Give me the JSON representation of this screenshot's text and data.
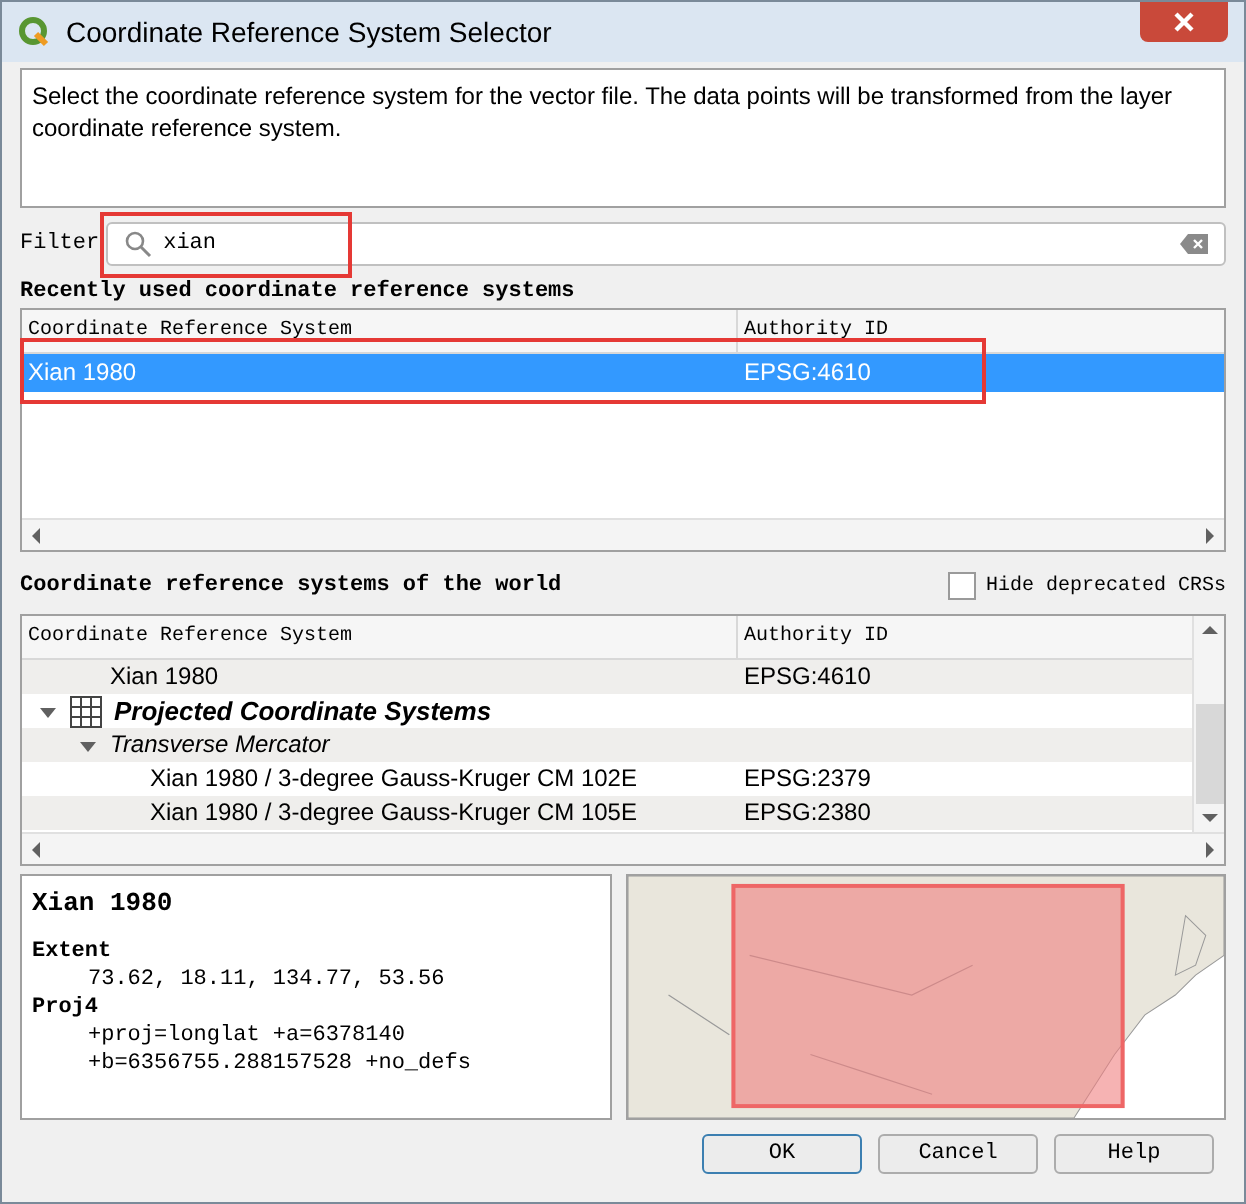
{
  "window": {
    "title": "Coordinate Reference System Selector"
  },
  "description": "Select the coordinate reference system for the vector file. The data points will be transformed from the layer coordinate reference system.",
  "filter": {
    "label": "Filter",
    "value": "xian"
  },
  "recent": {
    "heading": "Recently used coordinate reference systems",
    "columns": [
      "Coordinate Reference System",
      "Authority ID"
    ],
    "rows": [
      {
        "name": "Xian 1980",
        "authority_id": "EPSG:4610",
        "selected": true
      }
    ]
  },
  "world": {
    "heading": "Coordinate reference systems of the world",
    "hide_deprecated": {
      "label": "Hide deprecated CRSs",
      "checked": false
    },
    "columns": [
      "Coordinate Reference System",
      "Authority ID"
    ],
    "tree": [
      {
        "kind": "crs",
        "name": "Xian 1980",
        "authority_id": "EPSG:4610"
      },
      {
        "kind": "group",
        "name": "Projected Coordinate Systems",
        "expanded": true,
        "children": [
          {
            "kind": "projection",
            "name": "Transverse Mercator",
            "expanded": true,
            "children": [
              {
                "kind": "crs",
                "name": "Xian 1980 / 3-degree Gauss-Kruger CM 102E",
                "authority_id": "EPSG:2379"
              },
              {
                "kind": "crs",
                "name": "Xian 1980 / 3-degree Gauss-Kruger CM 105E",
                "authority_id": "EPSG:2380"
              }
            ]
          }
        ]
      }
    ]
  },
  "details": {
    "name": "Xian 1980",
    "extent_label": "Extent",
    "extent": "73.62, 18.11, 134.77, 53.56",
    "proj4_label": "Proj4",
    "proj4_lines": [
      "+proj=longlat +a=6378140",
      "+b=6356755.288157528 +no_defs"
    ]
  },
  "buttons": [
    "OK",
    "Cancel",
    "Help"
  ]
}
